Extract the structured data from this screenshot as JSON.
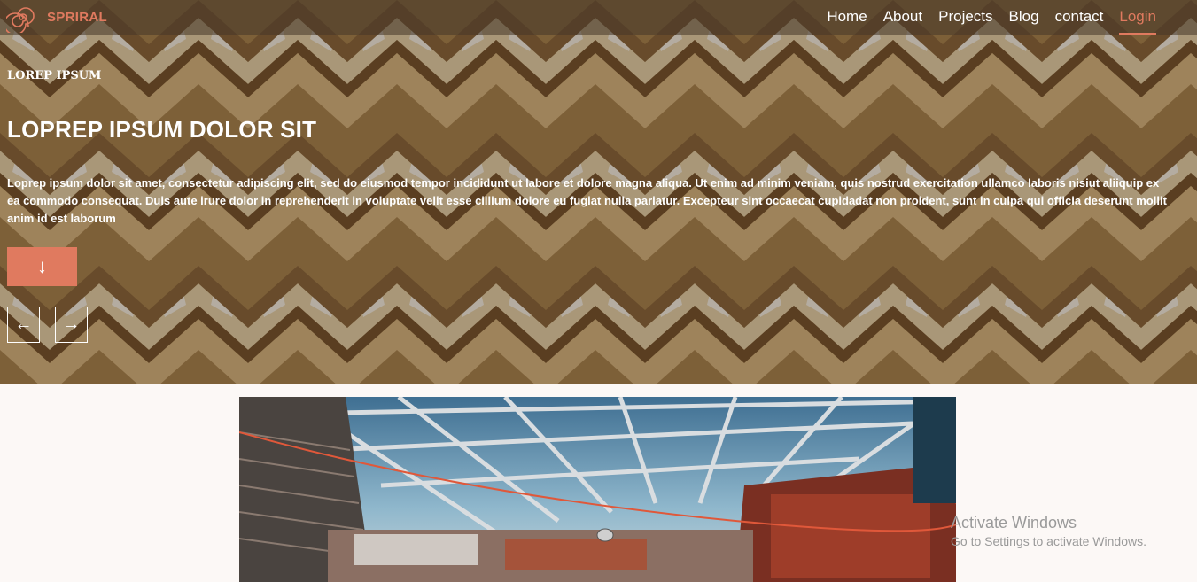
{
  "brand": {
    "name": "SPRIRAL",
    "accent": "#e07a5f"
  },
  "nav": {
    "items": [
      "Home",
      "About",
      "Projects",
      "Blog",
      "contact"
    ],
    "login_label": "Login"
  },
  "hero": {
    "eyebrow": "LOREP IPSUM",
    "title": "LOPREP IPSUM DOLOR SIT",
    "body": "Loprep ipsum dolor sit amet, consectetur adipiscing elit, sed do eiusmod tempor incididunt ut labore et dolore magna aliqua. Ut enim ad minim veniam, quis nostrud exercitation ullamco laboris nisiut aliiquip ex ea commodo consequat. Duis aute irure dolor in reprehenderit in voluptate velit esse ciilium dolore eu fugiat nulla pariatur. Excepteur sint occaecat cupidadat non proident, sunt in culpa qui officia deserunt mollit anim id est laborum",
    "down_icon": "↓",
    "prev_icon": "←",
    "next_icon": "→"
  },
  "icons": {
    "logo": "spiral-icon",
    "down": "arrow-down-icon",
    "prev": "arrow-left-icon",
    "next": "arrow-right-icon"
  },
  "watermark": {
    "title": "Activate Windows",
    "subtitle": "Go to Settings to activate Windows."
  }
}
